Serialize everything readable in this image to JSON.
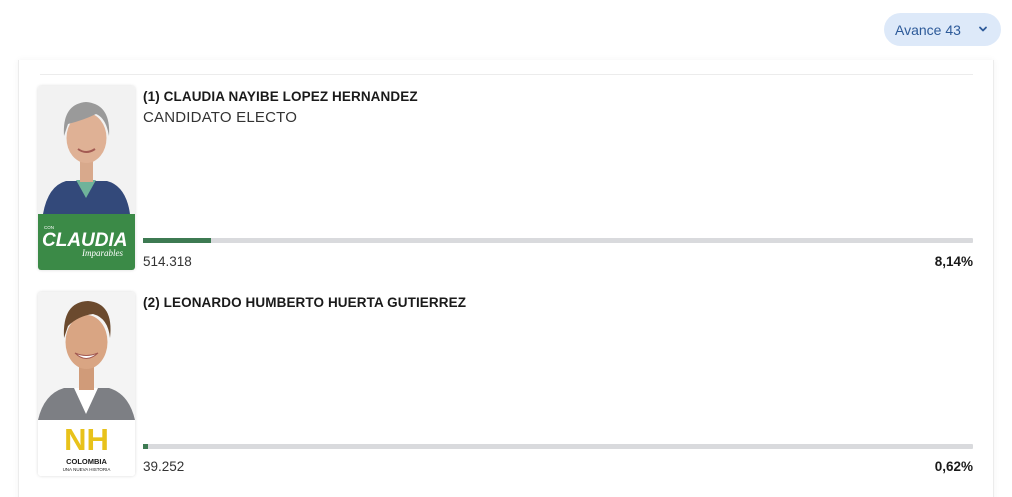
{
  "avance_dropdown": {
    "label": "Avance 43",
    "icon": "chevron-down-icon",
    "color": "#2d5a99",
    "background": "#dde9f9"
  },
  "colors": {
    "bar_fill": "#3d7a52",
    "bar_track": "#d9dadd",
    "claudia_badge": "#3b8a47"
  },
  "candidates": [
    {
      "name": "(1) CLAUDIA NAYIBE LOPEZ HERNANDEZ",
      "status": "CANDIDATO ELECTO",
      "votes": "514.318",
      "percentage": "8,14%",
      "share": 0.0814,
      "logo": {
        "prefix": "CON",
        "text": "CLAUDIA",
        "tagline": "Imparables"
      }
    },
    {
      "name": "(2) LEONARDO HUMBERTO HUERTA GUTIERREZ",
      "status": "",
      "votes": "39.252",
      "percentage": "0,62%",
      "share": 0.0062,
      "logo": {
        "text": "NH",
        "title": "COLOMBIA",
        "tagline": "UNA NUEVA HISTORIA"
      }
    }
  ]
}
